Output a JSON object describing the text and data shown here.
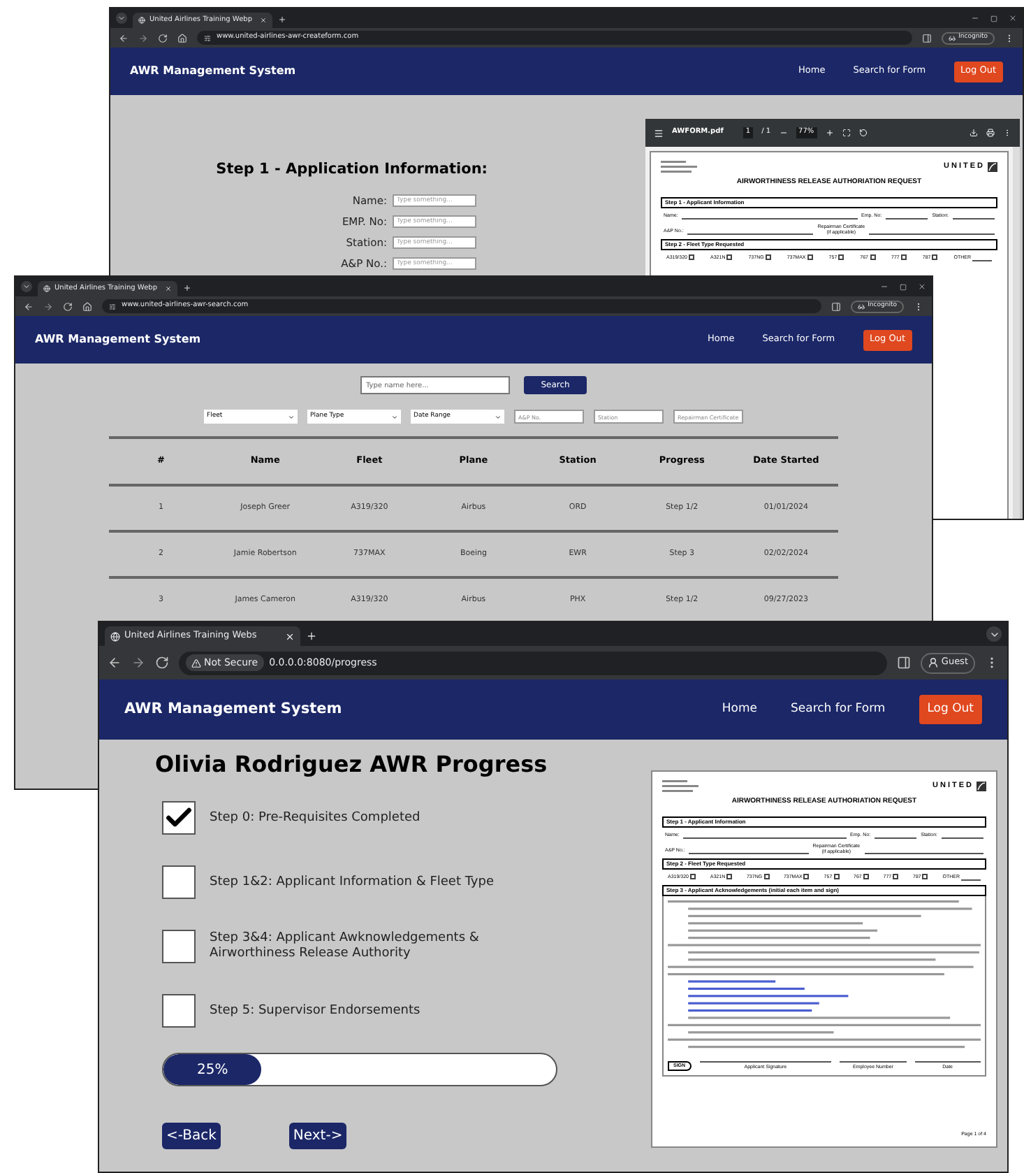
{
  "windows": [
    {
      "kind": "create_form",
      "tab": {
        "title": "United Airlines Training Webp"
      },
      "address": {
        "url": "www.united-airlines-awr-createform.com"
      },
      "profile": {
        "kind": "incognito",
        "label": "Incognito"
      },
      "header": {
        "brand": "AWR Management System",
        "links": [
          "Home",
          "Search for Form"
        ],
        "logout": "Log Out"
      },
      "form": {
        "heading": "Step 1 - Application Information:",
        "fields": [
          {
            "label": "Name:",
            "placeholder": "Type something..."
          },
          {
            "label": "EMP. No:",
            "placeholder": "Type something..."
          },
          {
            "label": "Station:",
            "placeholder": "Type something..."
          },
          {
            "label": "A&P No.:",
            "placeholder": "Type something..."
          }
        ]
      },
      "pdf_viewer": {
        "file": "AWFORM.pdf",
        "page": "1",
        "page_count": "/ 1",
        "zoom": "77%",
        "document": {
          "logo": "UNITED",
          "title": "AIRWORTHINESS RELEASE AUTHORIATION REQUEST",
          "sections": [
            {
              "kind": "applicant",
              "heading": "Step 1 - Applicant Information",
              "fields": [
                "Name:",
                "Emp. No:",
                "Station:",
                "A&P No.:",
                "Repairman Certificate"
              ],
              "note": "(if applicable)"
            },
            {
              "kind": "fleet",
              "heading": "Step 2 - Fleet Type Requested",
              "options": [
                {
                  "label": "A319/320",
                  "checked": false
                },
                {
                  "label": "A321N",
                  "checked": false
                },
                {
                  "label": "737NG",
                  "checked": false
                },
                {
                  "label": "737MAX",
                  "checked": false
                },
                {
                  "label": "757",
                  "checked": false
                },
                {
                  "label": "767",
                  "checked": false
                },
                {
                  "label": "777",
                  "checked": false
                },
                {
                  "label": "787",
                  "checked": false
                }
              ],
              "other": "OTHER"
            }
          ]
        }
      }
    },
    {
      "kind": "search",
      "tab": {
        "title": "United Airlines Training Webp"
      },
      "address": {
        "url": "www.united-airlines-awr-search.com"
      },
      "profile": {
        "kind": "incognito",
        "label": "Incognito"
      },
      "header": {
        "brand": "AWR Management System",
        "links": [
          "Home",
          "Search for Form"
        ],
        "logout": "Log Out"
      },
      "search": {
        "placeholder": "Type name here...",
        "button": "Search"
      },
      "filters": [
        {
          "kind": "select",
          "label": "Fleet"
        },
        {
          "kind": "select",
          "label": "Plane Type"
        },
        {
          "kind": "select",
          "label": "Date Range"
        },
        {
          "kind": "input",
          "placeholder": "A&P No."
        },
        {
          "kind": "input",
          "placeholder": "Station"
        },
        {
          "kind": "input",
          "placeholder": "Repairman Certificate"
        }
      ],
      "table": {
        "columns": [
          "#",
          "Name",
          "Fleet",
          "Plane",
          "Station",
          "Progress",
          "Date Started"
        ],
        "rows": [
          [
            "1",
            "Joseph Greer",
            "A319/320",
            "Airbus",
            "ORD",
            "Step 1/2",
            "01/01/2024"
          ],
          [
            "2",
            "Jamie Robertson",
            "737MAX",
            "Boeing",
            "EWR",
            "Step 3",
            "02/02/2024"
          ],
          [
            "3",
            "James Cameron",
            "A319/320",
            "Airbus",
            "PHX",
            "Step 1/2",
            "09/27/2023"
          ]
        ]
      }
    },
    {
      "kind": "progress",
      "tab": {
        "title": "United Airlines Training Webs"
      },
      "address": {
        "security": "Not Secure",
        "url": "0.0.0.0:8080/progress"
      },
      "profile": {
        "kind": "guest",
        "label": "Guest"
      },
      "header": {
        "brand": "AWR Management System",
        "links": [
          "Home",
          "Search for Form"
        ],
        "logout": "Log Out"
      },
      "title": "Olivia Rodriguez AWR Progress",
      "steps": [
        {
          "label": "Step 0: Pre-Requisites Completed",
          "checked": true
        },
        {
          "label": "Step 1&2: Applicant Information & Fleet Type",
          "checked": false
        },
        {
          "label": "Step 3&4: Applicant Awknowledgements & Airworthiness Release Authority",
          "checked": false
        },
        {
          "label": "Step 5: Supervisor Endorsements",
          "checked": false
        }
      ],
      "progress": {
        "level": 0.25,
        "label": "25%"
      },
      "buttons": [
        "<-Back",
        "Next->"
      ],
      "document": {
        "logo": "UNITED",
        "title": "AIRWORTHINESS RELEASE AUTHORIATION REQUEST",
        "sections": [
          {
            "kind": "applicant",
            "heading": "Step 1 - Applicant Information",
            "fields": [
              "Name:",
              "Emp. No:",
              "Station:",
              "A&P No.:",
              "Repairman Certificate"
            ],
            "note": "(if applicable)"
          },
          {
            "kind": "fleet",
            "heading": "Step 2 - Fleet Type Requested",
            "options": [
              {
                "label": "A319/320",
                "checked": false
              },
              {
                "label": "A321N",
                "checked": false
              },
              {
                "label": "737NG",
                "checked": false
              },
              {
                "label": "737MAX",
                "checked": false
              },
              {
                "label": "757",
                "checked": false
              },
              {
                "label": "767",
                "checked": false
              },
              {
                "label": "777",
                "checked": false
              },
              {
                "label": "787",
                "checked": false
              }
            ],
            "other": "OTHER"
          },
          {
            "kind": "acknowledgements",
            "heading": "Step 3 - Applicant Acknowledgements (initial each item and sign)",
            "sign": "SIGN",
            "signature_labels": [
              "Applicant Signature",
              "Employee Number",
              "Date"
            ]
          }
        ],
        "footer": "Page 1 of 4"
      }
    }
  ]
}
